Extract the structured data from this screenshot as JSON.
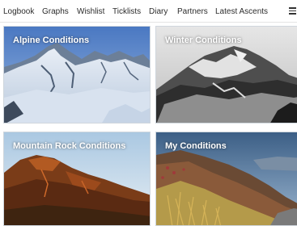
{
  "nav": {
    "items": [
      "Logbook",
      "Graphs",
      "Wishlist",
      "Ticklists",
      "Diary",
      "Partners",
      "Latest Ascents"
    ],
    "menu_icon": "hamburger-menu-icon"
  },
  "cards": [
    {
      "title": "Alpine Conditions",
      "image": "snowy-alpine-peaks"
    },
    {
      "title": "Winter Conditions",
      "image": "black-and-white-winter-ridge"
    },
    {
      "title": "Mountain Rock Conditions",
      "image": "sunlit-rock-mountain"
    },
    {
      "title": "My Conditions",
      "image": "autumn-grass-crag"
    }
  ]
}
